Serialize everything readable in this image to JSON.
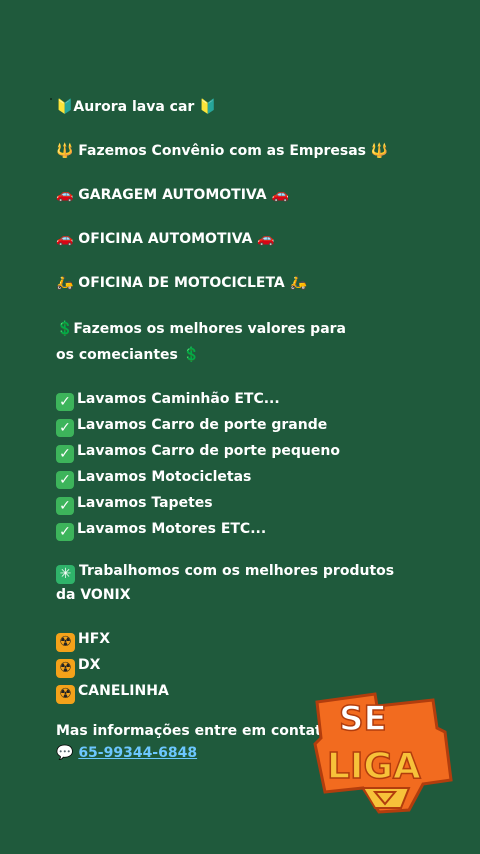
{
  "post": {
    "header": "🔰Aurora lava car 🔰",
    "convenio": "🔱 Fazemos Convênio com as Empresas 🔱",
    "garagem": "🚗 GARAGEM AUTOMOTIVA 🚗",
    "oficina_auto": "🚗 OFICINA AUTOMOTIVA 🚗",
    "oficina_moto": "🛵 OFICINA DE MOTOCICLETA 🛵",
    "valores": "💲Fazemos os melhores valores para os comeciantes 💲",
    "services": [
      "Lavamos Caminhão ETC...",
      "Lavamos Carro de porte grande",
      "Lavamos Carro de porte pequeno",
      "Lavamos Motocicletas",
      "Lavamos Tapetes",
      "Lavamos Motores ETC..."
    ],
    "produtos": "Trabalhomos com os melhores produtos da VONIX",
    "products": [
      "HFX",
      "DX",
      "CANELINHA"
    ],
    "contact_label": "Mas informações entre em contato",
    "phone": "65-99344-6848"
  },
  "badge": {
    "line1": "SE",
    "line2": "LIGA"
  },
  "colors": {
    "background": "#1f5a3c",
    "link": "#6cc7ff",
    "badge_orange": "#f26b1f",
    "badge_yellow": "#f7c23a"
  }
}
